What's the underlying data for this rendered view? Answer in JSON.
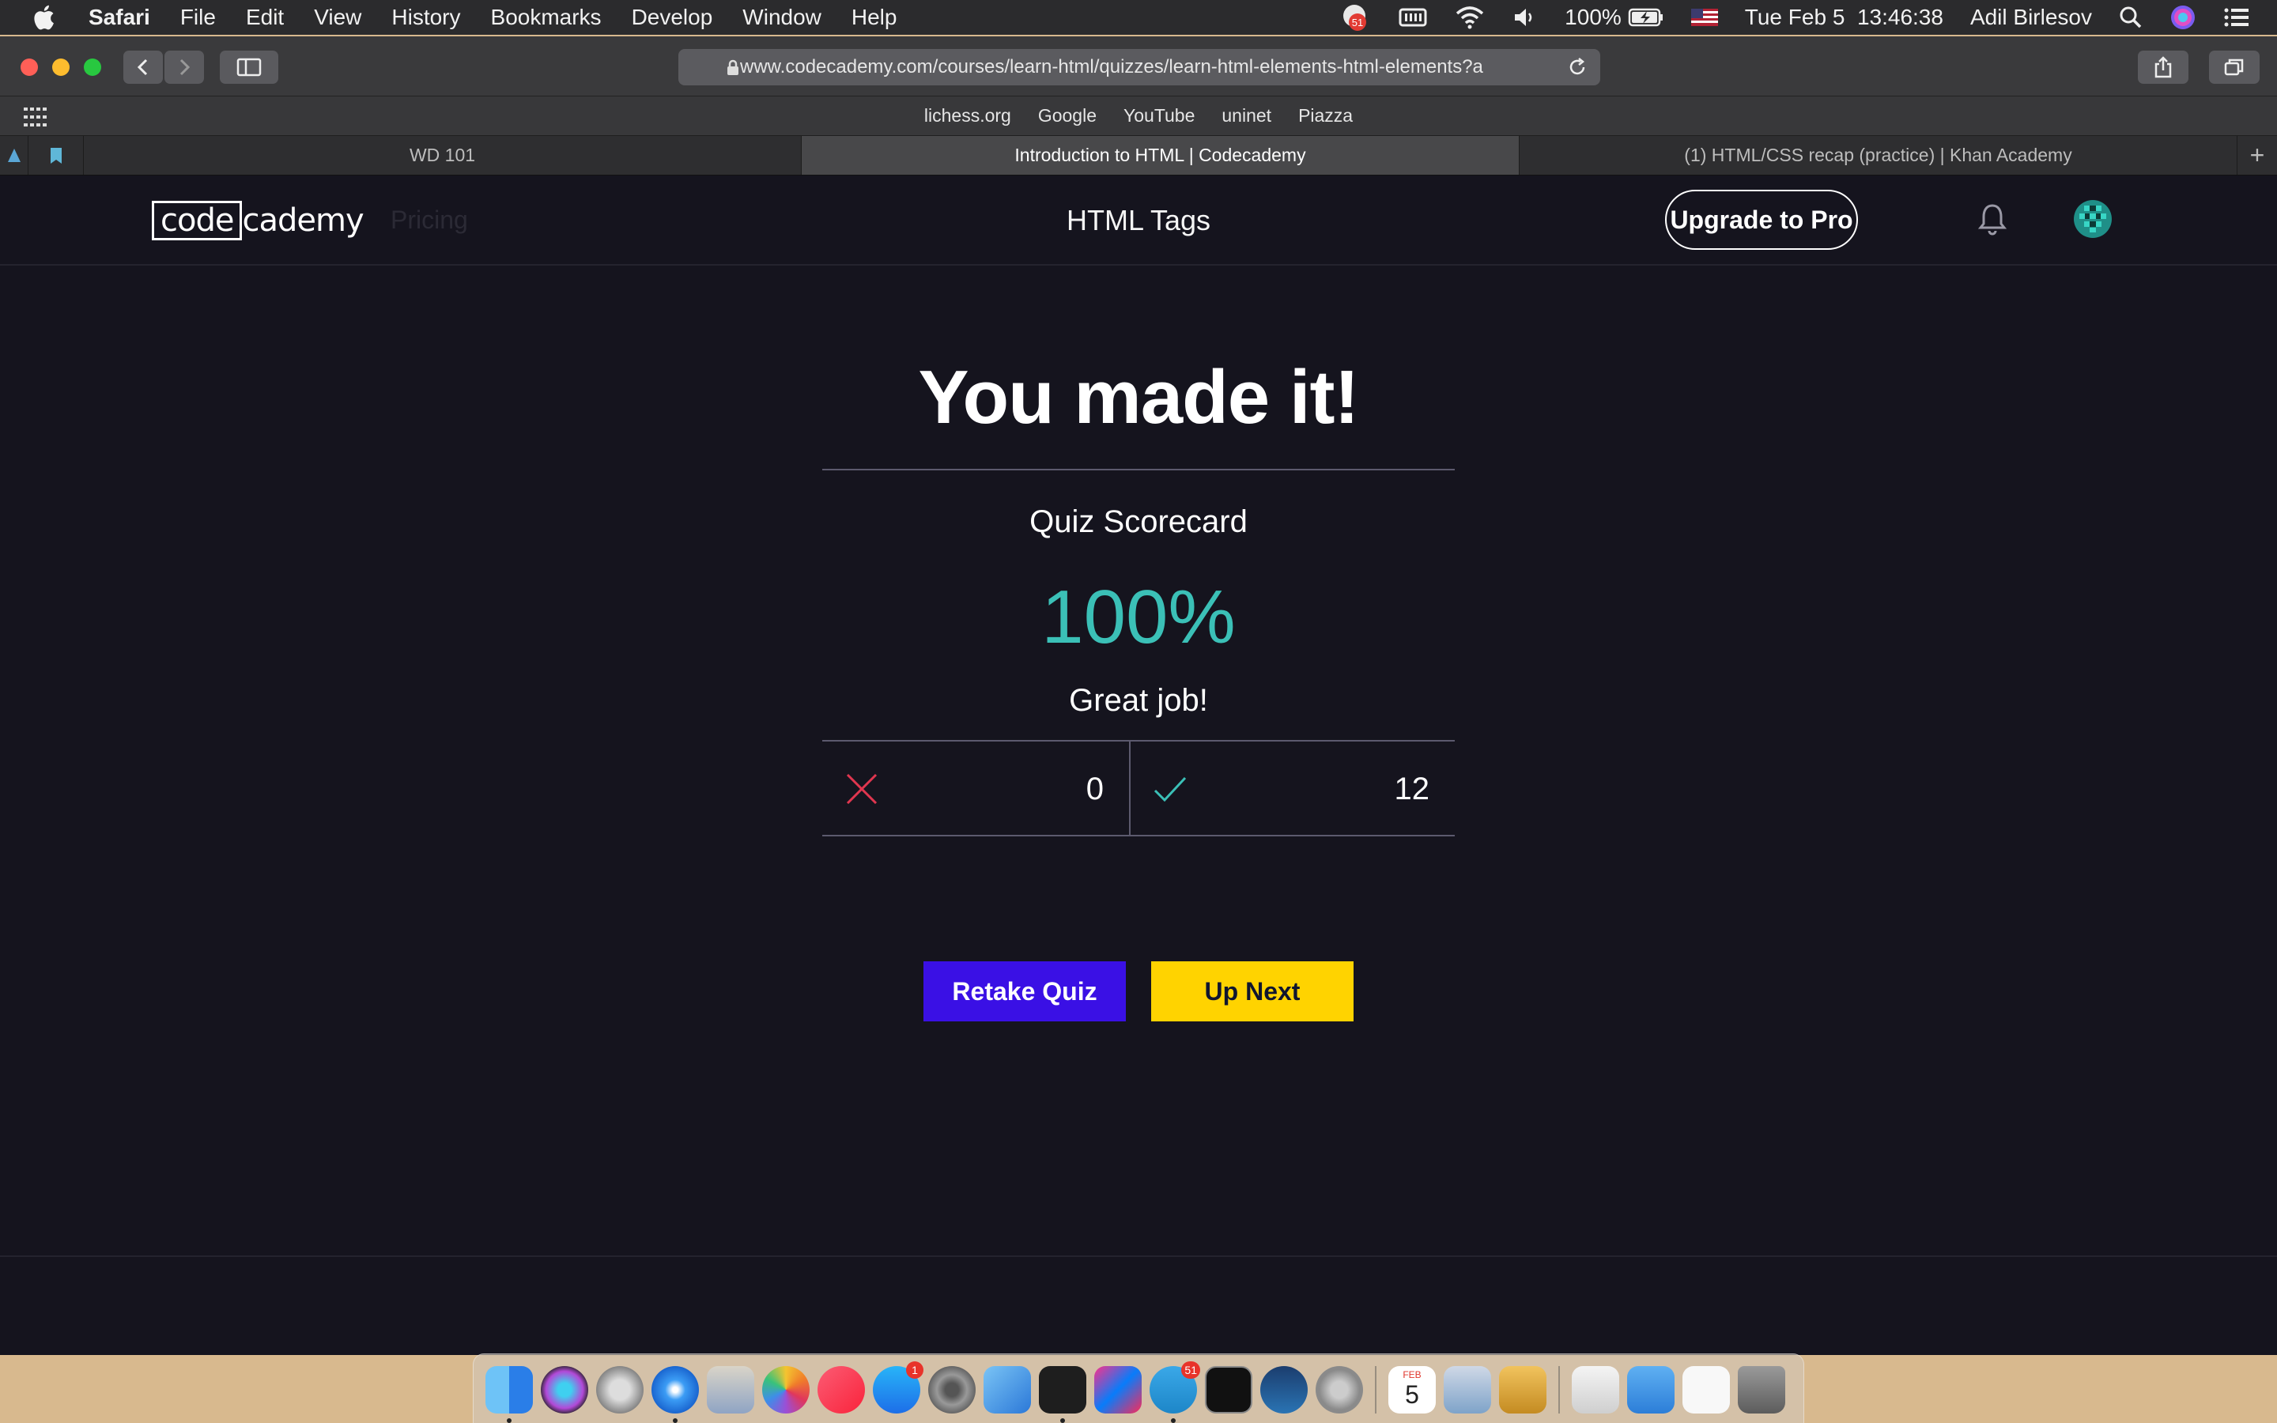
{
  "menubar": {
    "app": "Safari",
    "items": [
      "File",
      "Edit",
      "View",
      "History",
      "Bookmarks",
      "Develop",
      "Window",
      "Help"
    ],
    "status": {
      "notification_badge": "51",
      "battery": "100%",
      "datetime": "Tue Feb 5  13:46:38",
      "user": "Adil Birlesov"
    },
    "icons": [
      "apple-icon",
      "notification-icon",
      "keyboard-icon",
      "wifi-icon",
      "volume-icon",
      "battery-icon",
      "flag-icon",
      "spotlight-icon",
      "siri-icon",
      "notification-center-icon"
    ]
  },
  "browser": {
    "url": "www.codecademy.com/courses/learn-html/quizzes/learn-html-elements-html-elements?a",
    "favorites": [
      "lichess.org",
      "Google",
      "YouTube",
      "uninet",
      "Piazza"
    ],
    "tabs": [
      {
        "label": "WD 101",
        "active": false
      },
      {
        "label": "Introduction to HTML | Codecademy",
        "active": true
      },
      {
        "label": "(1) HTML/CSS recap (practice) | Khan Academy",
        "active": false
      }
    ],
    "traffic_colors": {
      "close": "#ff5f57",
      "minimize": "#febc2e",
      "maximize": "#28c840"
    }
  },
  "site": {
    "logo_boxed": "code",
    "logo_rest": "cademy",
    "pricing_label": "Pricing",
    "header_title": "HTML Tags",
    "upgrade_label": "Upgrade to Pro"
  },
  "result": {
    "title": "You made it!",
    "scorecard_label": "Quiz Scorecard",
    "score_percent": "100%",
    "message": "Great job!",
    "incorrect_count": "0",
    "correct_count": "12",
    "colors": {
      "score": "#3bc0b7",
      "incorrect": "#e0364f",
      "correct": "#3bc0b7"
    }
  },
  "actions": {
    "retake_label": "Retake Quiz",
    "next_label": "Up Next",
    "colors": {
      "retake": "#3a10e5",
      "next": "#ffd300"
    }
  },
  "dock": {
    "apps": [
      "finder-icon",
      "siri-icon",
      "launchpad-icon",
      "safari-icon",
      "mail-icon",
      "photos-icon",
      "music-icon",
      "app-store-icon",
      "system-preferences-icon",
      "xcode-icon",
      "vscode-icon",
      "intellij-icon",
      "telegram-icon",
      "terminal-icon",
      "steam-icon",
      "keychain-icon",
      "calendar-icon",
      "preview-icon",
      "shield-app-icon",
      "documents-icon",
      "downloads-folder-icon",
      "file-icon",
      "trash-icon"
    ],
    "app_store_badge": "1",
    "telegram_badge": "51",
    "calendar_day": "5",
    "calendar_month": "FEB"
  }
}
